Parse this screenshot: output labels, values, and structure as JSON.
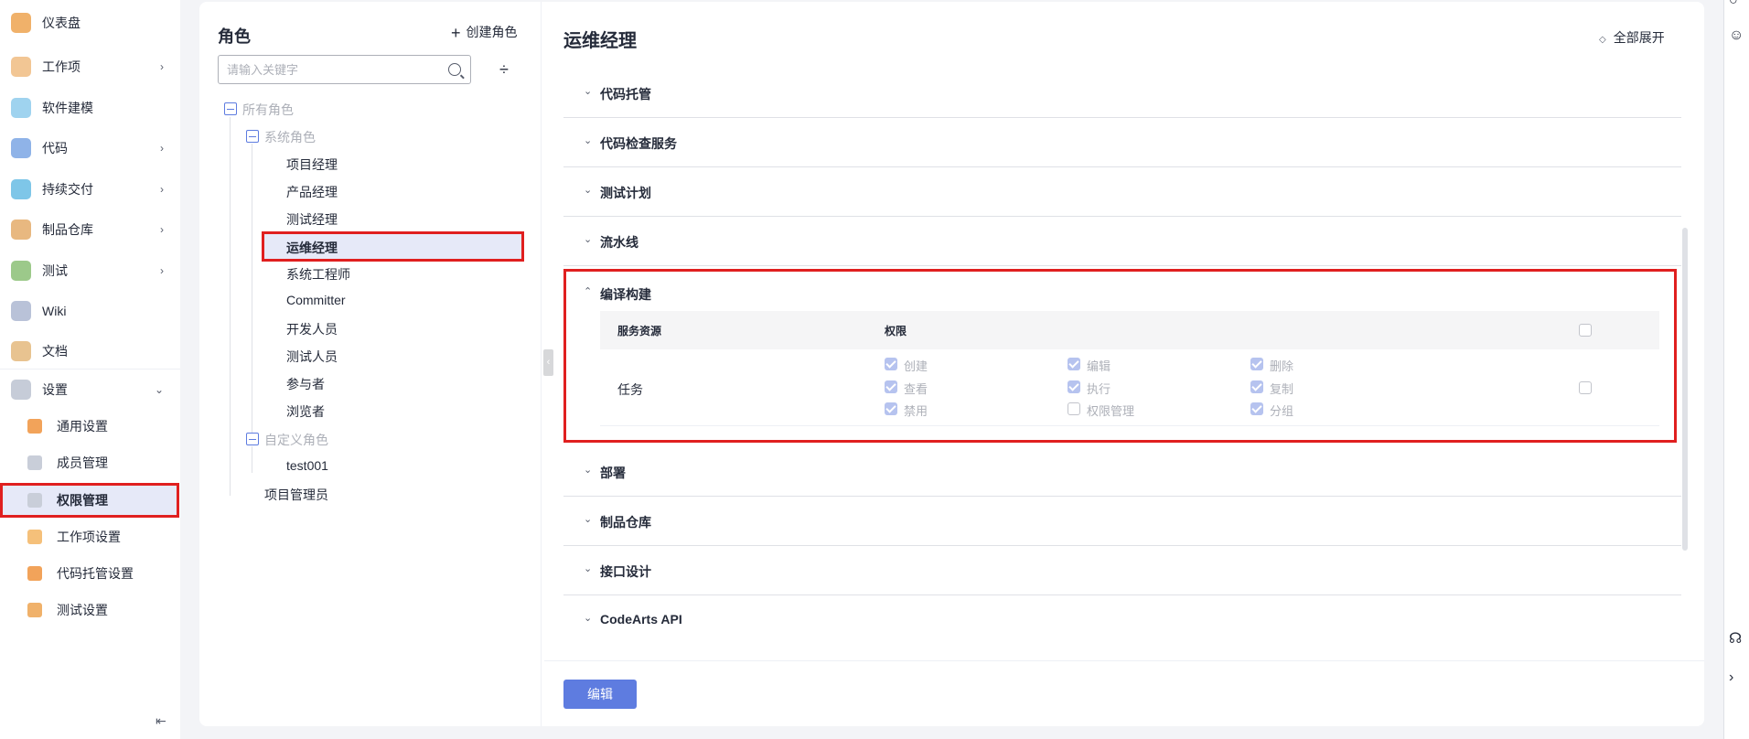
{
  "nav": {
    "items": [
      {
        "label": "仪表盘",
        "icon": "dashboard-icon",
        "chevron": ""
      },
      {
        "label": "工作项",
        "icon": "work-item-icon",
        "chevron": "›"
      },
      {
        "label": "软件建模",
        "icon": "modeling-icon",
        "chevron": ""
      },
      {
        "label": "代码",
        "icon": "code-icon",
        "chevron": "›"
      },
      {
        "label": "持续交付",
        "icon": "delivery-icon",
        "chevron": "›"
      },
      {
        "label": "制品仓库",
        "icon": "artifact-icon",
        "chevron": "›"
      },
      {
        "label": "测试",
        "icon": "test-icon",
        "chevron": "›"
      },
      {
        "label": "Wiki",
        "icon": "wiki-icon",
        "chevron": ""
      },
      {
        "label": "文档",
        "icon": "docs-icon",
        "chevron": ""
      },
      {
        "label": "设置",
        "icon": "settings-icon",
        "chevron": "⌄"
      }
    ],
    "sub_items": [
      {
        "label": "通用设置",
        "icon": "general-settings-icon"
      },
      {
        "label": "成员管理",
        "icon": "member-icon"
      },
      {
        "label": "权限管理",
        "icon": "permission-icon"
      },
      {
        "label": "工作项设置",
        "icon": "work-item-settings-icon"
      },
      {
        "label": "代码托管设置",
        "icon": "repo-settings-icon"
      },
      {
        "label": "测试设置",
        "icon": "test-settings-icon"
      }
    ],
    "active_sub": "权限管理"
  },
  "roles": {
    "title": "角色",
    "create_label": "创建角色",
    "search_placeholder": "请输入关键字",
    "all_roles": "所有角色",
    "system_roles": "系统角色",
    "system_list": [
      "项目经理",
      "产品经理",
      "测试经理",
      "运维经理",
      "系统工程师",
      "Committer",
      "开发人员",
      "测试人员",
      "参与者",
      "浏览者"
    ],
    "selected": "运维经理",
    "custom_roles": "自定义角色",
    "custom_list": [
      "test001"
    ],
    "project_admin": "项目管理员"
  },
  "permissions": {
    "title": "运维经理",
    "expand_all": "全部展开",
    "sections": [
      "代码托管",
      "代码检查服务",
      "测试计划",
      "流水线",
      "编译构建",
      "部署",
      "制品仓库",
      "接口设计",
      "CodeArts API"
    ],
    "expanded_section": "编译构建",
    "table": {
      "col_resource": "服务资源",
      "col_permission": "权限",
      "row_name": "任务",
      "perms": [
        {
          "label": "创建",
          "checked": true
        },
        {
          "label": "编辑",
          "checked": true
        },
        {
          "label": "删除",
          "checked": true
        },
        {
          "label": "查看",
          "checked": true
        },
        {
          "label": "执行",
          "checked": true
        },
        {
          "label": "复制",
          "checked": true
        },
        {
          "label": "禁用",
          "checked": true
        },
        {
          "label": "权限管理",
          "checked": false
        },
        {
          "label": "分组",
          "checked": true
        }
      ]
    }
  },
  "footer": {
    "edit_label": "编辑"
  },
  "colors": {
    "accent": "#5e7ce0",
    "highlight_border": "#e01f1f",
    "selected_bg": "#e6e9f8"
  }
}
